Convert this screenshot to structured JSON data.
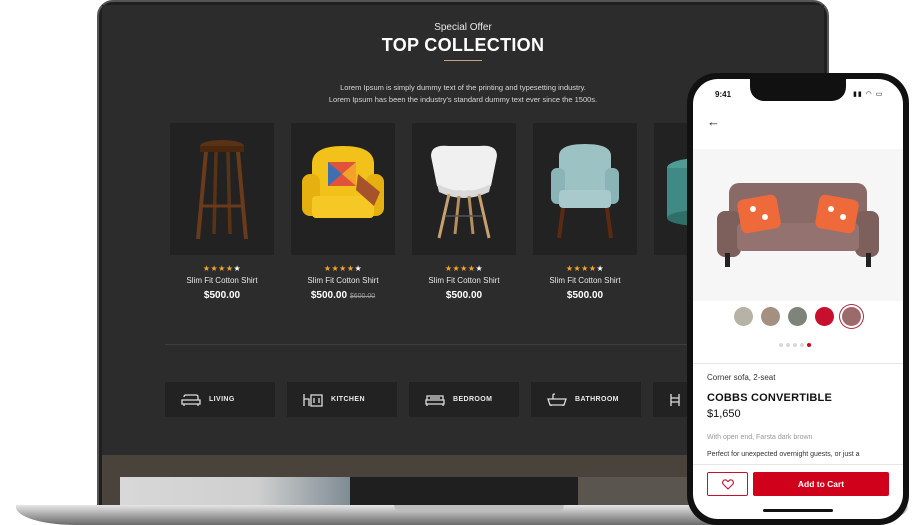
{
  "laptop": {
    "section": {
      "subtitle": "Special Offer",
      "title": "TOP COLLECTION",
      "description_line1": "Lorem Ipsum is simply dummy text of the printing and typesetting industry.",
      "description_line2": "Lorem Ipsum has been the industry's standard dummy text ever since the 1500s."
    },
    "products": [
      {
        "name": "Slim Fit Cotton Shirt",
        "price": "$500.00",
        "old_price": "",
        "rating": 4,
        "image": "bar-stool"
      },
      {
        "name": "Slim Fit Cotton Shirt",
        "price": "$500.00",
        "old_price": "$600.00",
        "rating": 4,
        "image": "yellow-armchair"
      },
      {
        "name": "Slim Fit Cotton Shirt",
        "price": "$500.00",
        "old_price": "",
        "rating": 4,
        "image": "white-shell-chair"
      },
      {
        "name": "Slim Fit Cotton Shirt",
        "price": "$500.00",
        "old_price": "",
        "rating": 4,
        "image": "teal-armchair"
      }
    ],
    "categories": [
      {
        "label": "LIVING",
        "icon": "sofa-icon"
      },
      {
        "label": "KITCHEN",
        "icon": "kitchen-icon"
      },
      {
        "label": "BEDROOM",
        "icon": "bed-icon"
      },
      {
        "label": "BATHROOM",
        "icon": "bathtub-icon"
      }
    ]
  },
  "phone": {
    "time": "9:41",
    "product_category": "Corner sofa, 2-seat",
    "product_name": "COBBS CONVERTIBLE",
    "price": "$1,650",
    "desc_line1": "With open end, Farsta dark brown",
    "desc_line2": "Perfect for unexpected overnight guests, or just a",
    "add_to_cart": "Add to Cart",
    "swatches": [
      "#b7b2a6",
      "#a58f80",
      "#7f847a",
      "#c8102e",
      "#9c6a6a"
    ],
    "selected_swatch": 4,
    "image_dots": 5,
    "active_dot": 4,
    "colors": {
      "accent": "#d0021b",
      "laptop_bg": "#2c2c2c",
      "star": "#f5a623"
    }
  }
}
